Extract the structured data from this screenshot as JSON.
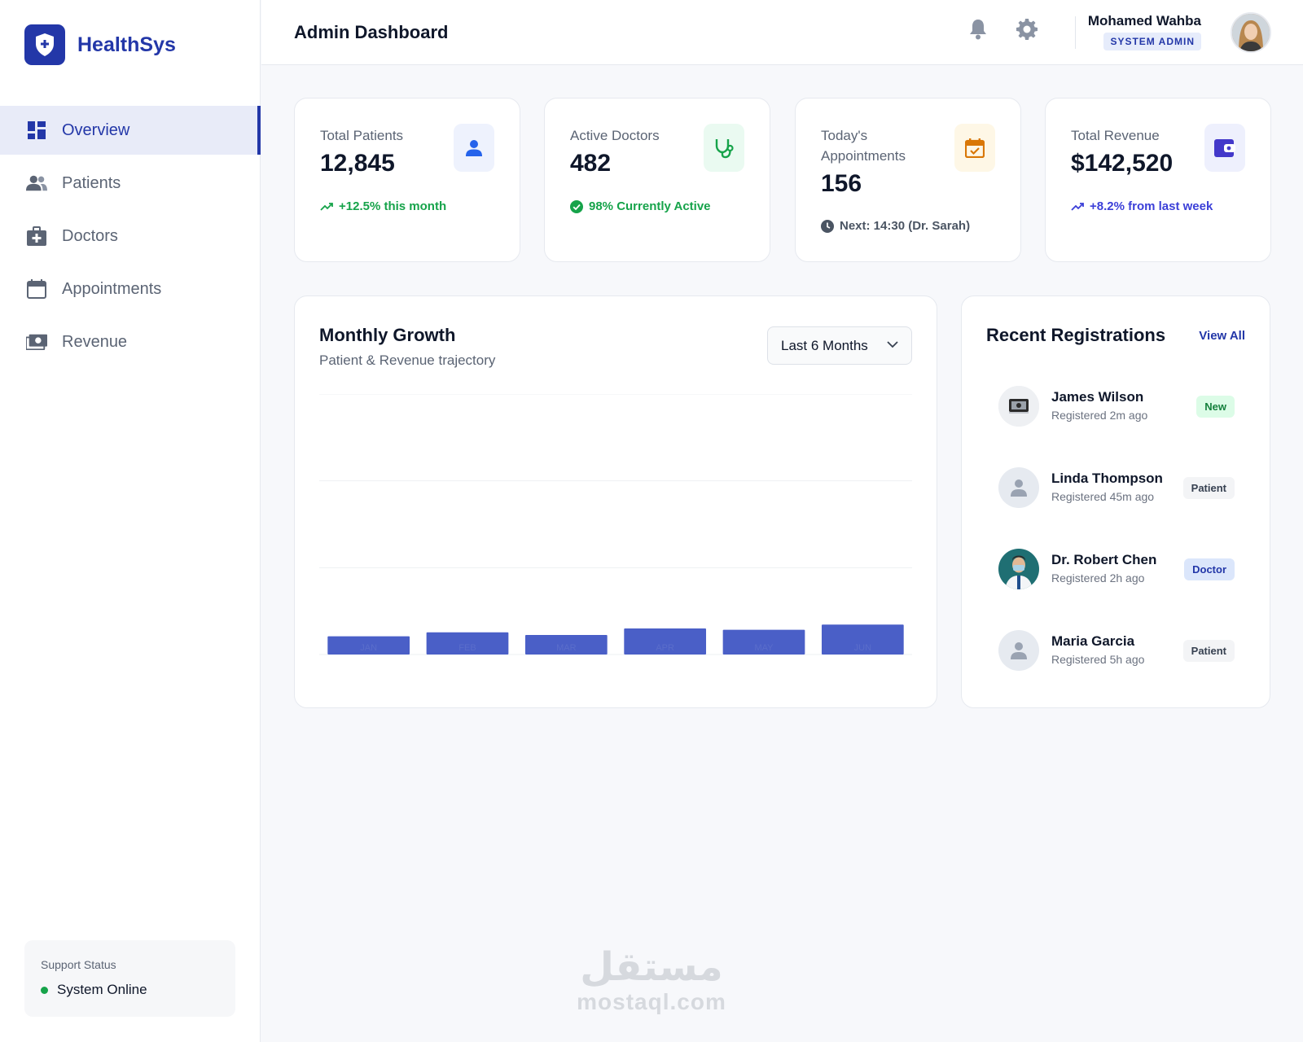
{
  "brand": {
    "name": "HealthSys",
    "color": "#2337a8"
  },
  "sidebar": {
    "items": [
      {
        "label": "Overview",
        "icon": "dashboard-icon",
        "active": true
      },
      {
        "label": "Patients",
        "icon": "users-icon",
        "active": false
      },
      {
        "label": "Doctors",
        "icon": "medical-bag-icon",
        "active": false
      },
      {
        "label": "Appointments",
        "icon": "calendar-icon",
        "active": false
      },
      {
        "label": "Revenue",
        "icon": "money-icon",
        "active": false
      }
    ],
    "support": {
      "title": "Support Status",
      "status": "System Online",
      "status_color": "#16a34a"
    }
  },
  "header": {
    "title": "Admin Dashboard",
    "user": {
      "name": "Mohamed Wahba",
      "role": "SYSTEM ADMIN"
    }
  },
  "stats": [
    {
      "label": "Total Patients",
      "value": "12,845",
      "note": "+12.5% this month",
      "note_color": "#16a34a",
      "icon": "person-icon",
      "icon_bg": "#eef2fd",
      "icon_color": "#2563eb"
    },
    {
      "label": "Active Doctors",
      "value": "482",
      "note": "98% Currently Active",
      "note_color": "#16a34a",
      "icon": "stethoscope-icon",
      "icon_bg": "#eafaf1",
      "icon_color": "#16a34a"
    },
    {
      "label": "Today's Appointments",
      "value": "156",
      "note": "Next: 14:30 (Dr. Sarah)",
      "note_color": "#4b5563",
      "icon": "calendar-check-icon",
      "icon_bg": "#fef7e6",
      "icon_color": "#d97706"
    },
    {
      "label": "Total Revenue",
      "value": "$142,520",
      "note": "+8.2% from last week",
      "note_color": "#3b3fd8",
      "icon": "wallet-icon",
      "icon_bg": "#eef0fd",
      "icon_color": "#4338ca"
    }
  ],
  "growth": {
    "title": "Monthly Growth",
    "subtitle": "Patient & Revenue trajectory",
    "range": "Last 6 Months"
  },
  "chart_data": {
    "type": "bar",
    "categories": [
      "JAN",
      "FEB",
      "MAR",
      "APR",
      "MAY",
      "JUN"
    ],
    "values": [
      7,
      8.5,
      7.5,
      10,
      9.5,
      11.5
    ],
    "ylim": [
      0,
      100
    ],
    "grid": true,
    "bar_color": "#4a5fc7"
  },
  "registrations": {
    "title": "Recent Registrations",
    "view_all": "View All",
    "items": [
      {
        "name": "James Wilson",
        "time": "Registered 2m ago",
        "badge": "New",
        "badge_bg": "#dcfce7",
        "badge_color": "#15803d",
        "avatar": "photo"
      },
      {
        "name": "Linda Thompson",
        "time": "Registered 45m ago",
        "badge": "Patient",
        "badge_bg": "#f3f4f6",
        "badge_color": "#374151",
        "avatar": "person-placeholder-icon"
      },
      {
        "name": "Dr. Robert Chen",
        "time": "Registered 2h ago",
        "badge": "Doctor",
        "badge_bg": "#dbe6fb",
        "badge_color": "#2337a8",
        "avatar": "photo"
      },
      {
        "name": "Maria Garcia",
        "time": "Registered 5h ago",
        "badge": "Patient",
        "badge_bg": "#f3f4f6",
        "badge_color": "#374151",
        "avatar": "person-placeholder-icon"
      }
    ]
  },
  "watermark": {
    "arabic": "مستقل",
    "latin": "mostaql.com"
  }
}
